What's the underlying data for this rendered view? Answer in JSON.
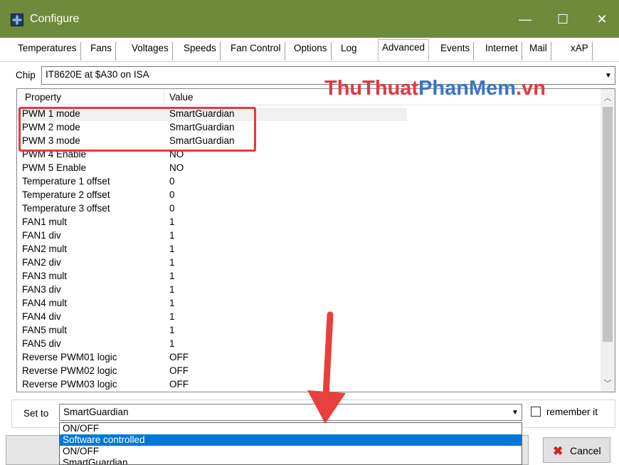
{
  "window": {
    "title": "Configure",
    "minimize_glyph": "—",
    "maximize_glyph": "☐",
    "close_glyph": "✕"
  },
  "tabs": [
    {
      "label": "Temperatures"
    },
    {
      "label": "Fans"
    },
    {
      "label": "Voltages"
    },
    {
      "label": "Speeds"
    },
    {
      "label": "Fan Control"
    },
    {
      "label": "Options"
    },
    {
      "label": "Log"
    },
    {
      "label": "Advanced"
    },
    {
      "label": "Events"
    },
    {
      "label": "Internet"
    },
    {
      "label": "Mail"
    },
    {
      "label": "xAP"
    }
  ],
  "chip": {
    "label": "Chip",
    "value": "IT8620E at $A30 on ISA"
  },
  "list": {
    "col_property": "Property",
    "col_value": "Value",
    "rows": [
      {
        "property": "PWM 1 mode",
        "value": "SmartGuardian"
      },
      {
        "property": "PWM 2 mode",
        "value": "SmartGuardian"
      },
      {
        "property": "PWM 3 mode",
        "value": "SmartGuardian"
      },
      {
        "property": "PWM 4 Enable",
        "value": "NO"
      },
      {
        "property": "PWM 5 Enable",
        "value": "NO"
      },
      {
        "property": "Temperature 1 offset",
        "value": "0"
      },
      {
        "property": "Temperature 2 offset",
        "value": "0"
      },
      {
        "property": "Temperature 3 offset",
        "value": "0"
      },
      {
        "property": "FAN1 mult",
        "value": "1"
      },
      {
        "property": "FAN1 div",
        "value": "1"
      },
      {
        "property": "FAN2 mult",
        "value": "1"
      },
      {
        "property": "FAN2 div",
        "value": "1"
      },
      {
        "property": "FAN3 mult",
        "value": "1"
      },
      {
        "property": "FAN3 div",
        "value": "1"
      },
      {
        "property": "FAN4 mult",
        "value": "1"
      },
      {
        "property": "FAN4 div",
        "value": "1"
      },
      {
        "property": "FAN5 mult",
        "value": "1"
      },
      {
        "property": "FAN5 div",
        "value": "1"
      },
      {
        "property": "Reverse PWM01 logic",
        "value": "OFF"
      },
      {
        "property": "Reverse PWM02 logic",
        "value": "OFF"
      },
      {
        "property": "Reverse PWM03 logic",
        "value": "OFF"
      }
    ]
  },
  "watermark": {
    "part1": "ThuThuat",
    "part2": "PhanMem",
    "part3": ".vn"
  },
  "set_to": {
    "label": "Set to",
    "value": "SmartGuardian",
    "remember_label": "remember it",
    "remember_checked": false
  },
  "dropdown_options": [
    {
      "label": "ON/OFF"
    },
    {
      "label": "Software controlled"
    },
    {
      "label": "ON/OFF"
    },
    {
      "label": "SmartGuardian"
    }
  ],
  "buttons": {
    "cancel_label": "Cancel"
  },
  "colors": {
    "titlebar": "#6e8a3b",
    "highlight": "#e23a3a",
    "selection": "#0078d7"
  }
}
